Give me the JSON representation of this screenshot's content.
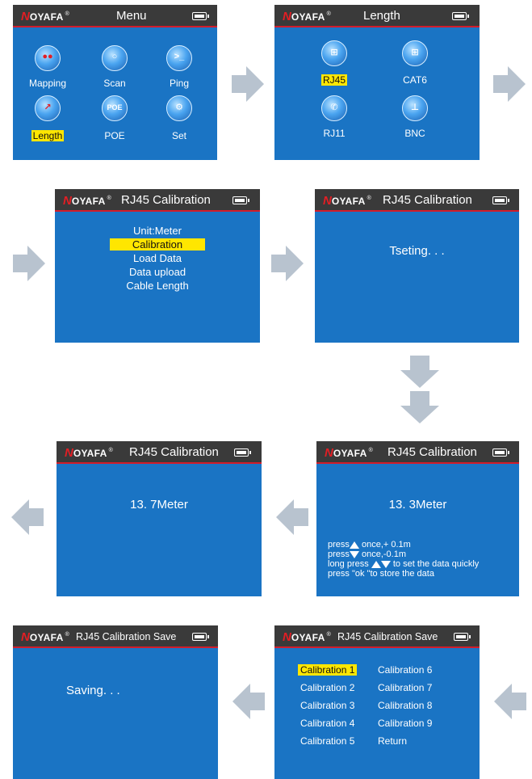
{
  "brand": {
    "letter": "N",
    "name": "OYAFA",
    "reg": "®"
  },
  "colors": {
    "screen_bg": "#1a74c4",
    "titlebar": "#3a3a3a",
    "highlight": "#ffe600",
    "accent_red": "#d21d2b",
    "arrow": "#b8c3cf"
  },
  "screen1": {
    "title": "Menu",
    "items": [
      {
        "label": "Mapping",
        "icon": "mapping-icon"
      },
      {
        "label": "Scan",
        "icon": "scan-icon"
      },
      {
        "label": "Ping",
        "icon": "ping-icon"
      },
      {
        "label": "Length",
        "icon": "length-icon"
      },
      {
        "label": "POE",
        "icon": "poe-icon"
      },
      {
        "label": "Set",
        "icon": "set-icon"
      }
    ],
    "selected": "Length",
    "poe_icon_text": "POE"
  },
  "screen2": {
    "title": "Length",
    "items": [
      {
        "label": "RJ45",
        "icon": "rj45-icon"
      },
      {
        "label": "CAT6",
        "icon": "cat6-icon"
      },
      {
        "label": "RJ11",
        "icon": "rj11-icon"
      },
      {
        "label": "BNC",
        "icon": "bnc-icon"
      }
    ],
    "selected": "RJ45"
  },
  "screen3": {
    "title": "RJ45 Calibration",
    "items": [
      "Unit:Meter",
      "Calibration",
      "Load Data",
      "Data upload",
      "Cable Length"
    ],
    "selected": "Calibration"
  },
  "screen4": {
    "title": "RJ45 Calibration",
    "status": "Tseting. . ."
  },
  "screen5": {
    "title": "RJ45 Calibration",
    "value": "13. 3Meter",
    "help": [
      {
        "prefix": "press",
        "suffix": " once,+ 0.1m"
      },
      {
        "prefix": "press",
        "suffix": " once,-0.1m"
      },
      {
        "prefix": "long press ",
        "suffix": " to set the data quickly"
      },
      {
        "prefix": "press \"ok \"to store the data",
        "suffix": ""
      }
    ]
  },
  "screen6": {
    "title": "RJ45 Calibration",
    "value": "13. 7Meter"
  },
  "screen7": {
    "title": "RJ45 Calibration Save",
    "left": [
      "Calibration 1",
      "Calibration 2",
      "Calibration 3",
      "Calibration 4",
      "Calibration 5"
    ],
    "right": [
      "Calibration 6",
      "Calibration 7",
      "Calibration 8",
      "Calibration 9",
      "Return"
    ],
    "selected": "Calibration 1"
  },
  "screen8": {
    "title": "RJ45 Calibration Save",
    "status": "Saving. . ."
  }
}
